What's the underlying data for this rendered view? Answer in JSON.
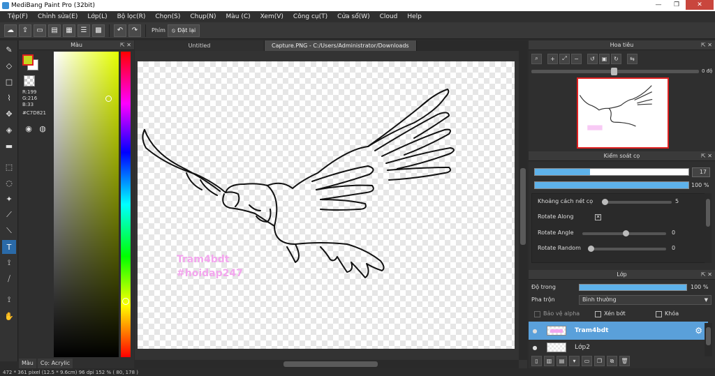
{
  "window": {
    "title": "MediBang Paint Pro (32bit)",
    "minimize": "—",
    "maximize": "❐",
    "close": "✕"
  },
  "menu": [
    "Tệp(F)",
    "Chỉnh sửa(E)",
    "Lớp(L)",
    "Bộ lọc(R)",
    "Chọn(S)",
    "Chụp(N)",
    "Màu (C)",
    "Xem(V)",
    "Công cụ(T)",
    "Cửa sổ(W)",
    "Cloud",
    "Help"
  ],
  "toolbar": {
    "shortcut_label": "Phím",
    "reset_label": "Đặt lại"
  },
  "color_panel": {
    "title": "Màu",
    "r": "R:199",
    "g": "G:216",
    "b": "B:33",
    "hex": "#C7D821",
    "fg_color": "#C7D821",
    "tabs": [
      "Màu",
      "Cọ: Acrylic"
    ]
  },
  "document": {
    "tabs": [
      "Untitled",
      "Capture.PNG - C:/Users/Administrator/Downloads"
    ],
    "watermark_line1": "Tram4bdt",
    "watermark_line2": "#hoidap247"
  },
  "navigator": {
    "title": "Hoa tiêu",
    "rotation": "0 độ"
  },
  "brush_control": {
    "title": "Kiểm soát cọ",
    "size_value": "17",
    "opacity_value": "100 %",
    "size_fill_pct": 36,
    "props": {
      "spacing_label": "Khoảng cách nét cọ",
      "spacing_value": "5",
      "rotate_along_label": "Rotate Along",
      "rotate_along_checked": "✕",
      "rotate_angle_label": "Rotate Angle",
      "rotate_angle_value": "0",
      "rotate_random_label": "Rotate Random",
      "rotate_random_value": "0"
    }
  },
  "layer_panel": {
    "title": "Lớp",
    "opacity_label": "Độ trong",
    "opacity_value": "100 %",
    "blend_label": "Pha trộn",
    "blend_value": "Bình thường",
    "protect_alpha": "Bảo vệ alpha",
    "clipping": "Xén bớt",
    "lock": "Khóa",
    "layers": [
      {
        "name": "Tram4bdt",
        "active": true
      },
      {
        "name": "Lớp2",
        "active": false
      }
    ]
  },
  "status": {
    "text": "472 * 361 pixel   (12.5 * 9.6cm)   96 dpi   152 %   ( 80, 178 )"
  },
  "icons": {
    "app": "medibang-app-icon",
    "cloud": "cloud-icon",
    "settings": "gear-icon"
  }
}
